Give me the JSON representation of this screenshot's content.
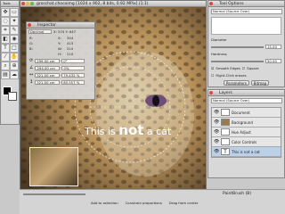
{
  "tools_window": {
    "title": "Tools"
  },
  "doc_window": {
    "title": "groschat.chocoimg [1024 x 902, 8 bits, 0.92 MPix] (1:1)"
  },
  "canvas": {
    "overlay_text_before": "This is ",
    "overlay_text_bold": "not",
    "overlay_text_after": " a cat"
  },
  "inspector": {
    "title": "Inspector",
    "unit": "Decimal",
    "coords": "X: 574  Y: 647",
    "R": "R:",
    "G": "G:",
    "B": "B:",
    "x_label": "X:",
    "x_val": "344",
    "y_label": "Y:",
    "y_val": "415",
    "w_label": "W:",
    "w_val": "210",
    "h_label": "H:",
    "h_val": "210",
    "f1": "299.00 cm",
    "f1b": "0°",
    "f2": "294.00 cm",
    "f2b": "0%",
    "f3": "321.00 cm",
    "f3b": "79.432 %",
    "f4": "321.00 cm",
    "f4b": "80.557 %"
  },
  "tool_options": {
    "title": "Tool Options",
    "brush_select": "Normal (Source Over)",
    "diameter_label": "Diameter",
    "diameter_val": "15.00",
    "hardness_label": "Hardness",
    "hardness_val": "50.00",
    "smooth_label": "Smooth Edges",
    "square_label": "Square",
    "right_click_label": "Right-Click erases",
    "btn1": "Parameters",
    "btn2": "Bitmap"
  },
  "layers": {
    "title": "Layers",
    "blend": "Normal (Source Over)",
    "items": [
      {
        "name": "Document"
      },
      {
        "name": "Background"
      },
      {
        "name": "Hue Adjust"
      },
      {
        "name": "Color Controls"
      },
      {
        "name": "This is not a cat"
      }
    ]
  },
  "status": {
    "tool": "PaintBrush (B)",
    "opt1": "Add to selection",
    "opt2": "Constrain proportions",
    "opt3": "Drag from center"
  },
  "colors": {
    "accent": "#3b6fb5",
    "panel": "#d8d8d8"
  }
}
